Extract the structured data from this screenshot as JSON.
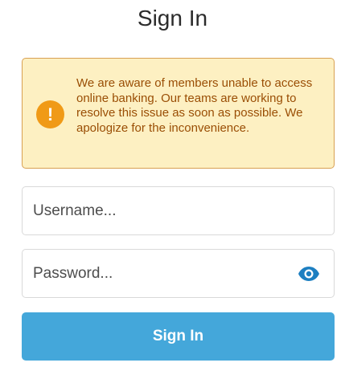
{
  "page": {
    "title": "Sign In"
  },
  "alert": {
    "icon": "exclamation-icon",
    "message": "We are aware of members unable to access online banking. Our teams are working to resolve this issue as soon as possible. We apologize for the inconvenience.",
    "background_color": "#fdf0c2",
    "border_color": "#d8a052",
    "text_color": "#9a4e05",
    "icon_color": "#f09a17"
  },
  "form": {
    "username": {
      "placeholder": "Username...",
      "value": ""
    },
    "password": {
      "placeholder": "Password...",
      "value": "",
      "toggle_icon": "eye-icon"
    },
    "submit_label": "Sign In",
    "submit_color": "#44a7da"
  }
}
